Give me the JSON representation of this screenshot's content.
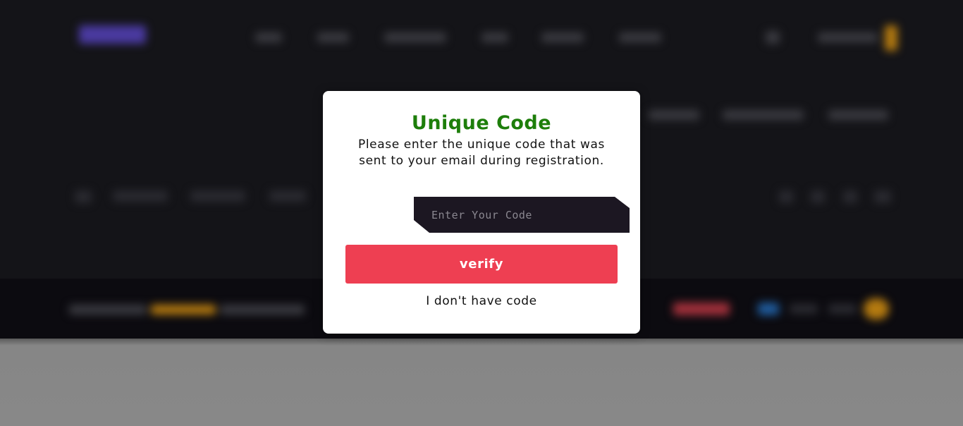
{
  "modal": {
    "title": "Unique Code",
    "description": "Please enter the unique code that was sent to your email during registration.",
    "code_input": {
      "value": "",
      "placeholder": "Enter Your Code"
    },
    "verify_label": "verify",
    "no_code_label": "I don't have code"
  },
  "colors": {
    "title": "#1d7e0a",
    "verify_button": "#ee3f52",
    "input_background": "#1c1722",
    "page_background": "#141418",
    "overlay_grey": "#888888"
  }
}
